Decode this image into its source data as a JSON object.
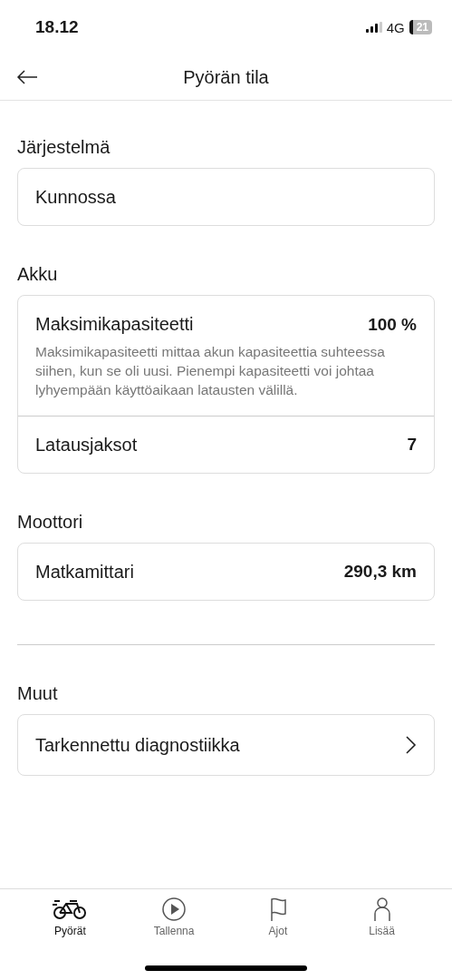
{
  "status_bar": {
    "time": "18.12",
    "network": "4G",
    "battery": "21"
  },
  "header": {
    "title": "Pyörän tila"
  },
  "sections": [
    {
      "title": "Järjestelmä",
      "divider_before": false,
      "rows": [
        {
          "kind": "plain",
          "label": "Kunnossa"
        }
      ]
    },
    {
      "title": "Akku",
      "divider_before": false,
      "rows": [
        {
          "kind": "value",
          "label": "Maksimikapasiteetti",
          "value": "100 %",
          "description": "Maksimikapasiteetti mittaa akun kapasiteettia suhteessa siihen, kun se oli uusi. Pienempi kapasiteetti voi johtaa lyhyempään käyttöaikaan latausten välillä."
        },
        {
          "kind": "value",
          "label": "Latausjaksot",
          "value": "7"
        }
      ]
    },
    {
      "title": "Moottori",
      "divider_before": false,
      "rows": [
        {
          "kind": "value",
          "label": "Matkamittari",
          "value": "290,3 km"
        }
      ]
    },
    {
      "title": "Muut",
      "divider_before": true,
      "rows": [
        {
          "kind": "link",
          "label": "Tarkennettu diagnostiikka"
        }
      ]
    }
  ],
  "tab_bar": [
    {
      "label": "Pyörät",
      "selected": true
    },
    {
      "label": "Tallenna",
      "selected": false
    },
    {
      "label": "Ajot",
      "selected": false
    },
    {
      "label": "Lisää",
      "selected": false
    }
  ]
}
